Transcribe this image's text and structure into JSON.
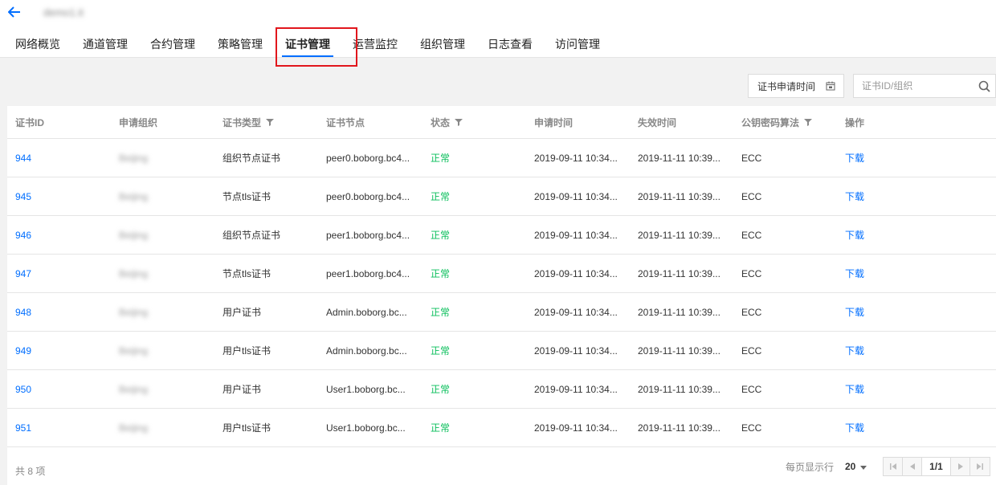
{
  "header": {
    "instance_name": "demo1.it",
    "tabs": [
      {
        "label": "网络概览"
      },
      {
        "label": "通道管理"
      },
      {
        "label": "合约管理"
      },
      {
        "label": "策略管理"
      },
      {
        "label": "证书管理",
        "active": true
      },
      {
        "label": "运营监控"
      },
      {
        "label": "组织管理"
      },
      {
        "label": "日志查看"
      },
      {
        "label": "访问管理"
      }
    ]
  },
  "toolbar": {
    "date_filter_label": "证书申请时间",
    "search_placeholder": "证书ID/组织"
  },
  "table": {
    "columns": [
      "证书ID",
      "申请组织",
      "证书类型",
      "证书节点",
      "状态",
      "申请时间",
      "失效时间",
      "公钥密码算法",
      "操作"
    ],
    "rows": [
      {
        "id": "944",
        "org": "Beijing",
        "type": "组织节点证书",
        "node": "peer0.boborg.bc4...",
        "status": "正常",
        "apply_time": "2019-09-11 10:34...",
        "expire_time": "2019-11-11 10:39...",
        "algorithm": "ECC",
        "action": "下载"
      },
      {
        "id": "945",
        "org": "Beijing",
        "type": "节点tls证书",
        "node": "peer0.boborg.bc4...",
        "status": "正常",
        "apply_time": "2019-09-11 10:34...",
        "expire_time": "2019-11-11 10:39...",
        "algorithm": "ECC",
        "action": "下载"
      },
      {
        "id": "946",
        "org": "Beijing",
        "type": "组织节点证书",
        "node": "peer1.boborg.bc4...",
        "status": "正常",
        "apply_time": "2019-09-11 10:34...",
        "expire_time": "2019-11-11 10:39...",
        "algorithm": "ECC",
        "action": "下载"
      },
      {
        "id": "947",
        "org": "Beijing",
        "type": "节点tls证书",
        "node": "peer1.boborg.bc4...",
        "status": "正常",
        "apply_time": "2019-09-11 10:34...",
        "expire_time": "2019-11-11 10:39...",
        "algorithm": "ECC",
        "action": "下载"
      },
      {
        "id": "948",
        "org": "Beijing",
        "type": "用户证书",
        "node": "Admin.boborg.bc...",
        "status": "正常",
        "apply_time": "2019-09-11 10:34...",
        "expire_time": "2019-11-11 10:39...",
        "algorithm": "ECC",
        "action": "下载"
      },
      {
        "id": "949",
        "org": "Beijing",
        "type": "用户tls证书",
        "node": "Admin.boborg.bc...",
        "status": "正常",
        "apply_time": "2019-09-11 10:34...",
        "expire_time": "2019-11-11 10:39...",
        "algorithm": "ECC",
        "action": "下载"
      },
      {
        "id": "950",
        "org": "Beijing",
        "type": "用户证书",
        "node": "User1.boborg.bc...",
        "status": "正常",
        "apply_time": "2019-09-11 10:34...",
        "expire_time": "2019-11-11 10:39...",
        "algorithm": "ECC",
        "action": "下载"
      },
      {
        "id": "951",
        "org": "Beijing",
        "type": "用户tls证书",
        "node": "User1.boborg.bc...",
        "status": "正常",
        "apply_time": "2019-09-11 10:34...",
        "expire_time": "2019-11-11 10:39...",
        "algorithm": "ECC",
        "action": "下载"
      }
    ]
  },
  "footer": {
    "total_text": "共 8 项",
    "per_page_label": "每页显示行",
    "per_page_value": "20",
    "page_indicator": "1/1"
  },
  "colors": {
    "accent": "#006eff",
    "status_ok": "#0abf5b",
    "highlight": "#e1161c"
  }
}
